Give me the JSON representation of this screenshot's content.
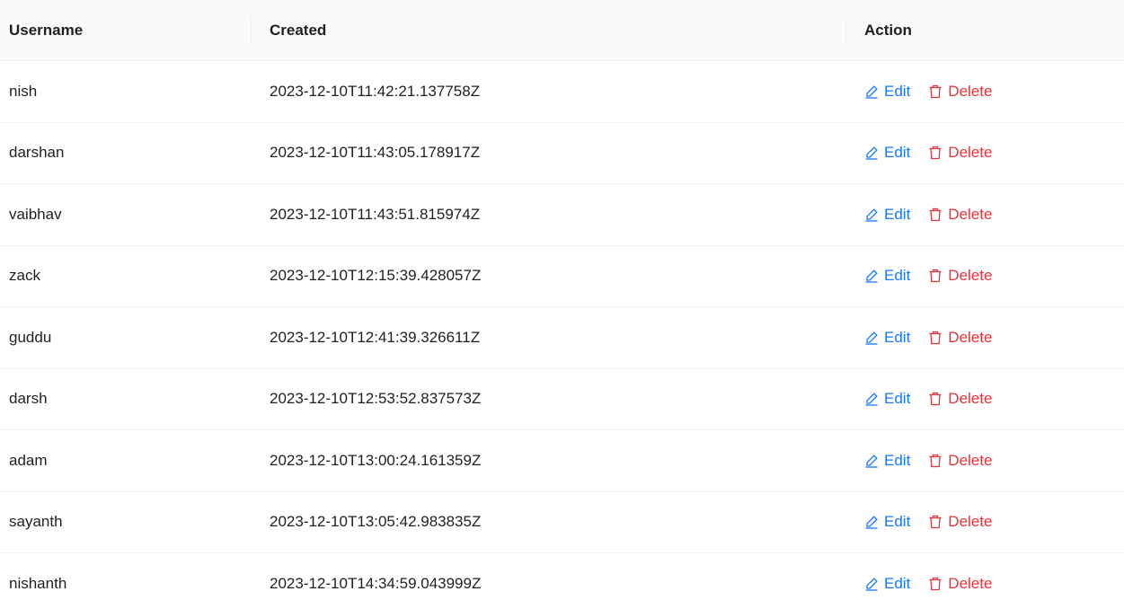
{
  "columns": {
    "username": "Username",
    "created": "Created",
    "action": "Action"
  },
  "actions": {
    "edit_label": "Edit",
    "delete_label": "Delete",
    "edit_icon": "edit-pen-icon",
    "delete_icon": "trash-icon"
  },
  "colors": {
    "edit": "#1677ff",
    "delete": "#e8323c",
    "header_bg": "#fafafa",
    "divider": "#f0f0f0"
  },
  "rows": [
    {
      "username": "nish",
      "created": "2023-12-10T11:42:21.137758Z"
    },
    {
      "username": "darshan",
      "created": "2023-12-10T11:43:05.178917Z"
    },
    {
      "username": "vaibhav",
      "created": "2023-12-10T11:43:51.815974Z"
    },
    {
      "username": "zack",
      "created": "2023-12-10T12:15:39.428057Z"
    },
    {
      "username": "guddu",
      "created": "2023-12-10T12:41:39.326611Z"
    },
    {
      "username": "darsh",
      "created": "2023-12-10T12:53:52.837573Z"
    },
    {
      "username": "adam",
      "created": "2023-12-10T13:00:24.161359Z"
    },
    {
      "username": "sayanth",
      "created": "2023-12-10T13:05:42.983835Z"
    },
    {
      "username": "nishanth",
      "created": "2023-12-10T14:34:59.043999Z"
    }
  ]
}
